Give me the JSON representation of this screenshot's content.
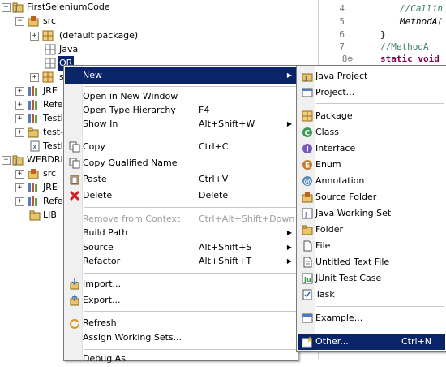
{
  "tree": {
    "project_name": "FirstSeleniumCode",
    "src": "src",
    "default_package": "(default package)",
    "java": "Java",
    "or": "OR",
    "s_partial": "s",
    "jre": "JRE",
    "refe1": "Refe",
    "testl1": "Testl",
    "test_folder": "test-",
    "testl2": "Testl",
    "webdriver": "WEBDRIVE",
    "src2": "src",
    "jre2": "JRE",
    "refe2": "Refe",
    "lib": "LIB"
  },
  "editor": {
    "lines": [
      {
        "num": "4",
        "text": "//Callin"
      },
      {
        "num": "5",
        "text": "MethodA("
      },
      {
        "num": "6",
        "text": "}"
      },
      {
        "num": "7",
        "text": "//MethodA"
      },
      {
        "num": "8⊖",
        "text": "static void"
      }
    ]
  },
  "context_menu": {
    "new": "New",
    "open_new_window": "Open in New Window",
    "open_type_hierarchy": "Open Type Hierarchy",
    "open_type_hierarchy_acc": "F4",
    "show_in": "Show In",
    "show_in_acc": "Alt+Shift+W",
    "copy": "Copy",
    "copy_acc": "Ctrl+C",
    "copy_qualified": "Copy Qualified Name",
    "paste": "Paste",
    "paste_acc": "Ctrl+V",
    "delete": "Delete",
    "delete_acc": "Delete",
    "remove_context": "Remove from Context",
    "remove_context_acc": "Ctrl+Alt+Shift+Down",
    "build_path": "Build Path",
    "source": "Source",
    "source_acc": "Alt+Shift+S",
    "refactor": "Refactor",
    "refactor_acc": "Alt+Shift+T",
    "import": "Import...",
    "export": "Export...",
    "refresh": "Refresh",
    "assign_working_sets": "Assign Working Sets...",
    "debug_as": "Debug As"
  },
  "submenu": {
    "java_project": "Java Project",
    "project": "Project...",
    "package": "Package",
    "class": "Class",
    "interface": "Interface",
    "enum": "Enum",
    "annotation": "Annotation",
    "source_folder": "Source Folder",
    "java_working_set": "Java Working Set",
    "folder": "Folder",
    "file": "File",
    "untitled_text_file": "Untitled Text File",
    "junit_test_case": "JUnit Test Case",
    "task": "Task",
    "example": "Example...",
    "other": "Other...",
    "other_acc": "Ctrl+N"
  },
  "colors": {
    "highlight": "#0a246a",
    "comment": "#3f7f5f",
    "keyword": "#7f0055"
  }
}
